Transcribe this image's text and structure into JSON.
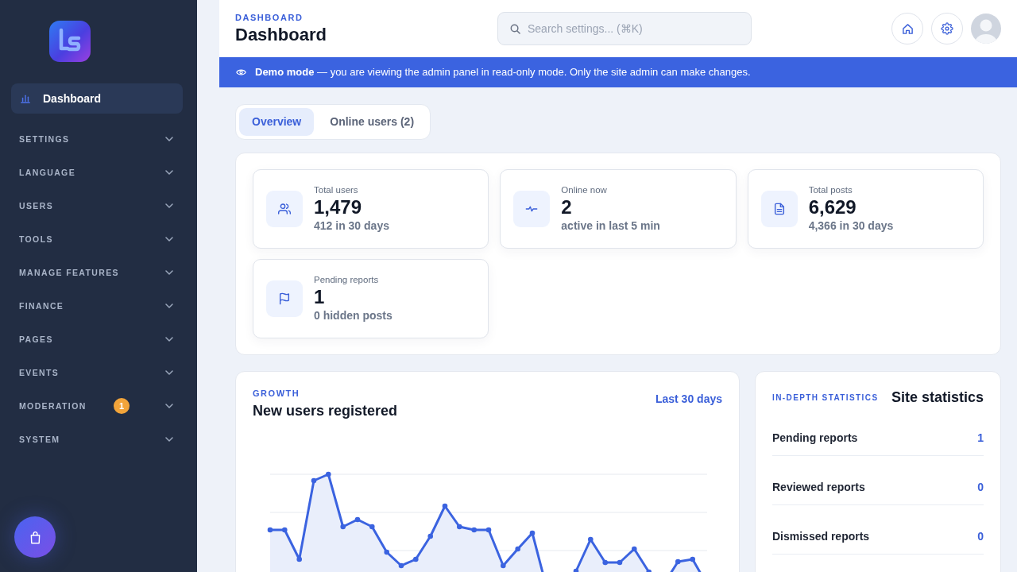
{
  "sidebar": {
    "nav_items": [
      {
        "label": "Dashboard",
        "selected": true
      }
    ],
    "sections": [
      {
        "label": "SETTINGS",
        "expanded": false
      },
      {
        "label": "LANGUAGE",
        "expanded": false
      },
      {
        "label": "USERS",
        "expanded": false
      },
      {
        "label": "TOOLS",
        "expanded": false
      },
      {
        "label": "MANAGE FEATURES",
        "expanded": false
      },
      {
        "label": "FINANCE",
        "expanded": false
      },
      {
        "label": "PAGES",
        "expanded": false
      },
      {
        "label": "EVENTS",
        "expanded": false
      },
      {
        "label": "MODERATION",
        "expanded": false,
        "badge": "1"
      },
      {
        "label": "SYSTEM",
        "expanded": false
      }
    ]
  },
  "header": {
    "eyebrow": "DASHBOARD",
    "title": "Dashboard",
    "search": {
      "placeholder": "Search settings... (⌘K)"
    }
  },
  "banner": {
    "text": "**Demo mode** — you are viewing the admin panel in read-only mode. Only the site admin can make changes."
  },
  "tabs": [
    {
      "label": "Overview",
      "selected": true
    },
    {
      "label": "Online users (2)",
      "selected": false
    }
  ],
  "stats": [
    {
      "label": "Total users",
      "value": "1,479",
      "detail": "412 in 30 days"
    },
    {
      "label": "Online now",
      "value": "2",
      "detail": "active in last 5 min"
    },
    {
      "label": "Total posts",
      "value": "6,629",
      "detail": "4,366 in 30 days"
    },
    {
      "label": "Pending reports",
      "value": "1",
      "detail": "0 hidden posts"
    }
  ],
  "growth": {
    "eyebrow": "GROWTH",
    "title": "New users registered",
    "range_link": "Last 30 days"
  },
  "site_statistics": {
    "eyebrow": "IN-DEPTH STATISTICS",
    "title": "Site statistics",
    "rows": [
      {
        "label": "Pending reports",
        "value": "1"
      },
      {
        "label": "Reviewed reports",
        "value": "0"
      },
      {
        "label": "Dismissed reports",
        "value": "0"
      }
    ]
  }
}
